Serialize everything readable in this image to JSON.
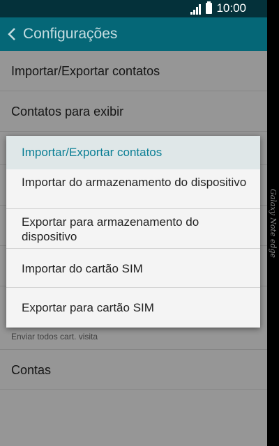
{
  "status": {
    "time": "10:00"
  },
  "header": {
    "title": "Configurações"
  },
  "list": {
    "items": [
      "Importar/Exportar contatos",
      "Contatos para exibir",
      "Contas"
    ],
    "section_label": "Enviar todos cart. visita"
  },
  "dialog": {
    "title": "Importar/Exportar contatos",
    "options": [
      "Importar do armazenamento do dispositivo",
      "Exportar para armazenamento do dispositivo",
      "Importar do cartão SIM",
      "Exportar para cartão SIM"
    ]
  },
  "device": {
    "edge_label": "Galaxy Note edge"
  },
  "colors": {
    "statusbar": "#04313a",
    "actionbar": "#056777",
    "dialog_title": "#0b7f95"
  },
  "icons": {
    "signal": "signal-icon",
    "battery": "battery-icon",
    "back": "back-chevron-icon"
  }
}
